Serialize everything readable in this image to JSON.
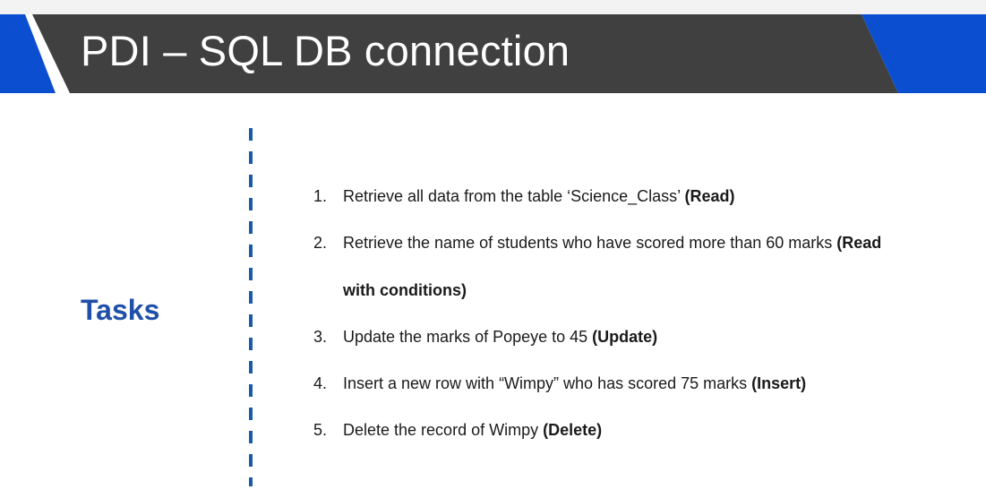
{
  "slide": {
    "title": "PDI – SQL DB connection",
    "section_label": "Tasks",
    "colors": {
      "header_band": "#404040",
      "accent_blue": "#0b4fd0",
      "label_blue": "#1f4fa8",
      "divider_blue": "#1a5aa8"
    },
    "tasks": [
      {
        "number": "1.",
        "text": "Retrieve all data from the table ‘Science_Class’ ",
        "operation": "(Read)"
      },
      {
        "number": "2.",
        "text": "Retrieve the name of students who have scored more than 60 marks ",
        "operation": "(Read",
        "operation_cont": "with conditions)"
      },
      {
        "number": "3.",
        "text": "Update the marks of Popeye to 45 ",
        "operation": "(Update)"
      },
      {
        "number": "4.",
        "text": "Insert a new row with “Wimpy” who has scored 75 marks ",
        "operation": "(Insert)"
      },
      {
        "number": "5.",
        "text": "Delete the record of Wimpy ",
        "operation": "(Delete)"
      }
    ]
  }
}
